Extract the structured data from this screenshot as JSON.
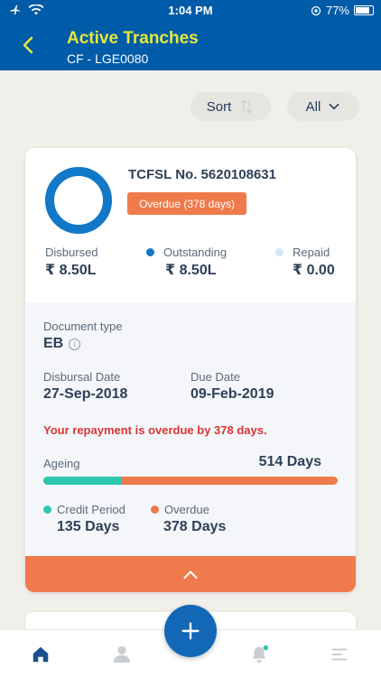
{
  "status_bar": {
    "time": "1:04 PM",
    "battery": "77%"
  },
  "header": {
    "title": "Active Tranches",
    "subtitle": "CF - LGE0080"
  },
  "toolbar": {
    "sort_label": "Sort",
    "filter_label": "All"
  },
  "tranche": {
    "number": "TCFSL No. 5620108631",
    "badge": "Overdue (378 days)",
    "amounts": [
      {
        "label": "Disbursed",
        "value": "₹ 8.50L",
        "dot_color": ""
      },
      {
        "label": "Outstanding",
        "value": "₹ 8.50L",
        "dot_color": "#1278c7"
      },
      {
        "label": "Repaid",
        "value": "₹ 0.00",
        "dot_color": "#d4e6f6"
      }
    ],
    "document_type_label": "Document type",
    "document_type_value": "EB",
    "disbursal_date_label": "Disbursal Date",
    "disbursal_date_value": "27-Sep-2018",
    "due_date_label": "Due Date",
    "due_date_value": "09-Feb-2019",
    "warning": "Your repayment is overdue by 378 days.",
    "ageing_label": "Ageing",
    "ageing_value": "514 Days",
    "ageing_credit_fraction": 0.263,
    "credit_period_label": "Credit Period",
    "credit_period_value": "135 Days",
    "overdue_label": "Overdue",
    "overdue_value": "378 Days"
  },
  "colors": {
    "appbar": "#005ba8",
    "title": "#e6e93a",
    "accent_orange": "#ef7a4b",
    "accent_teal": "#2dc7b0",
    "ring_blue": "#1278c7"
  },
  "icons": {
    "back": "chevron-left-icon",
    "sort": "sort-arrows-icon",
    "filter": "chevron-down-icon",
    "info": "info-icon",
    "expand": "chevron-up-icon",
    "fab": "plus-icon",
    "nav": [
      "home-icon",
      "user-icon",
      "bell-icon",
      "menu-icon"
    ]
  }
}
